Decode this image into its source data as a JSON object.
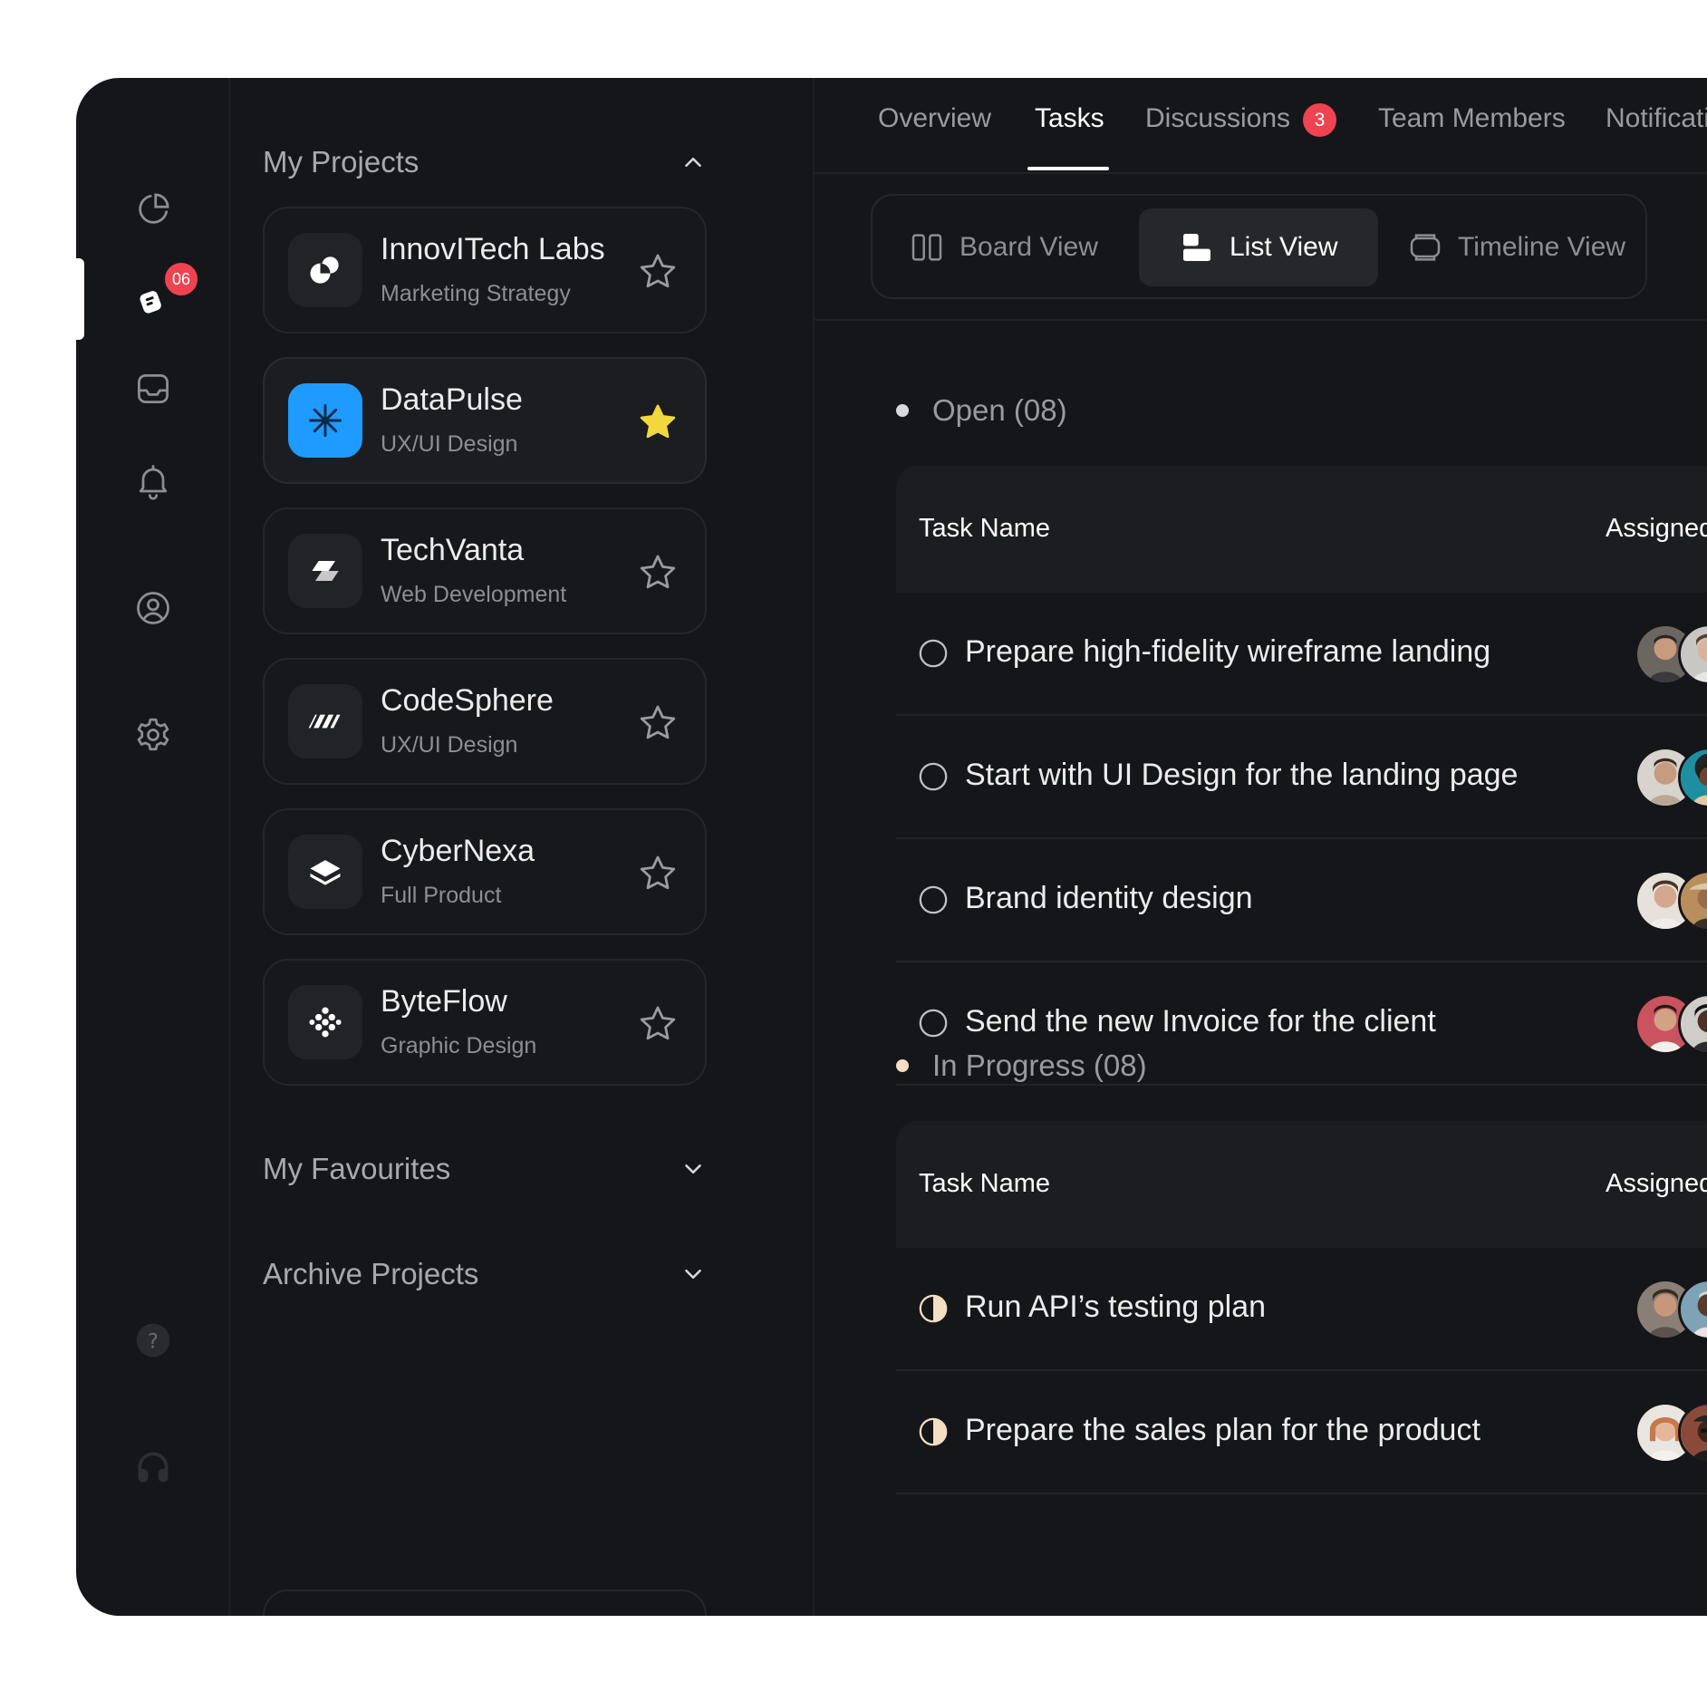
{
  "rail": {
    "badge": "06",
    "icons": [
      "pie-chart-icon",
      "projects-icon",
      "inbox-icon",
      "bell-icon",
      "user-icon",
      "gear-icon",
      "help-icon",
      "headset-icon"
    ]
  },
  "projects": {
    "my_projects_title": "My Projects",
    "items": [
      {
        "name": "InnovITech Labs",
        "sub": "Marketing Strategy",
        "starred": false,
        "logo": "innovitech-logo"
      },
      {
        "name": "DataPulse",
        "sub": "UX/UI Design",
        "starred": true,
        "logo": "datapulse-logo"
      },
      {
        "name": "TechVanta",
        "sub": "Web Development",
        "starred": false,
        "logo": "techvanta-logo"
      },
      {
        "name": "CodeSphere",
        "sub": "UX/UI Design",
        "starred": false,
        "logo": "codesphere-logo"
      },
      {
        "name": "CyberNexa",
        "sub": "Full Product",
        "starred": false,
        "logo": "cybernexa-logo"
      },
      {
        "name": "ByteFlow",
        "sub": "Graphic Design",
        "starred": false,
        "logo": "byteflow-logo"
      }
    ],
    "favourites_title": "My Favourites",
    "archive_title": "Archive Projects"
  },
  "tabs": {
    "overview": "Overview",
    "tasks": "Tasks",
    "discussions": "Discussions",
    "discussions_badge": "3",
    "team_members": "Team Members",
    "notifications": "Notifications"
  },
  "views": {
    "board": "Board View",
    "list": "List View",
    "timeline": "Timeline View"
  },
  "colors": {
    "background": "#151619",
    "accent_blue": "#1f9bff",
    "star_yellow": "#f1d93d",
    "badge_red": "#ef4352"
  },
  "groups": [
    {
      "label": "Open (08)",
      "header": {
        "task_name": "Task Name",
        "assigned_to": "Assigned to"
      },
      "tasks": [
        "Prepare high-fidelity wireframe landing",
        "Start with UI Design for the landing page",
        "Brand identity design",
        "Send the new Invoice for the client"
      ]
    },
    {
      "label": "In Progress (08)",
      "header": {
        "task_name": "Task Name",
        "assigned_to": "Assigned to"
      },
      "tasks": [
        "Run API’s testing plan",
        "Prepare the sales plan for the product"
      ]
    }
  ]
}
